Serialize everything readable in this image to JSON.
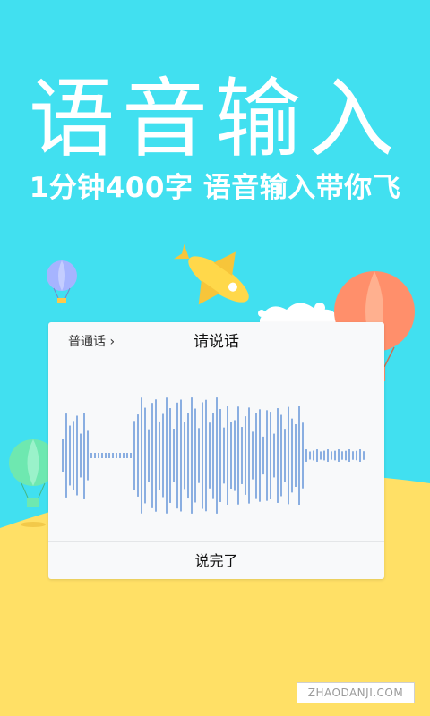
{
  "banner": {
    "title": "语音输入",
    "subtitle": "1分钟400字 语音输入带你飞"
  },
  "dialog": {
    "language_label": "普通话 ›",
    "title": "请说话",
    "done_label": "说完了"
  },
  "watermark": "ZHAODANJI.COM",
  "colors": {
    "background": "#41e0f0",
    "ground": "#ffe066",
    "waveform": "#5b8fd6",
    "balloon_orange": "#ff8f6b",
    "balloon_green": "#6ee8b0",
    "balloon_purple": "#a6b4ff",
    "rocket": "#ffd84a"
  }
}
